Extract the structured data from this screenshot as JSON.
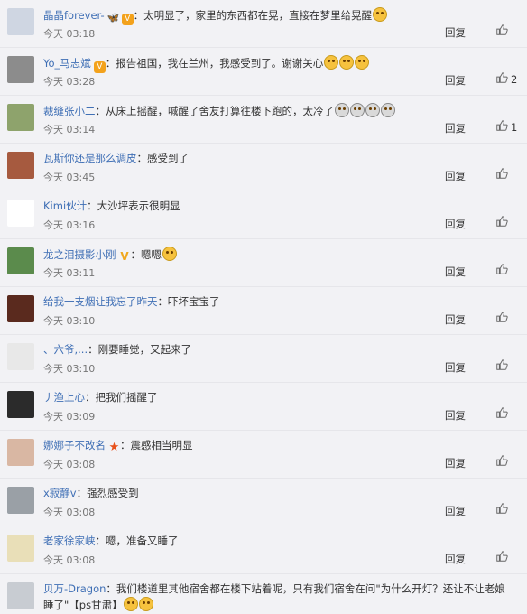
{
  "actions": {
    "reply_label": "回复",
    "like_icon": "thumbs-up-icon"
  },
  "comments": [
    {
      "user": "晶晶forever-",
      "text": "：太明显了，家里的东西都在晃，直接在梦里给晃醒",
      "time": "今天 03:18",
      "likes": "",
      "avatar_color": "#cfd6e2",
      "badges": [
        "butterfly",
        "vip"
      ],
      "emoji_count": 1
    },
    {
      "user": "Yo_马志斌",
      "text": "：报告祖国，我在兰州，我感受到了。谢谢关心",
      "time": "今天 03:28",
      "likes": "2",
      "avatar_color": "#8c8c8c",
      "badges": [
        "vip"
      ],
      "emoji_count": 3
    },
    {
      "user": "裁缝张小二",
      "text": "：从床上摇醒，喊醒了舍友打算往楼下跑的，太冷了",
      "time": "今天 03:14",
      "likes": "1",
      "avatar_color": "#8ea36c",
      "badges": [],
      "emoji_count": 4
    },
    {
      "user": "瓦斯你还是那么调皮",
      "text": "：感受到了",
      "time": "今天 03:45",
      "likes": "",
      "avatar_color": "#a65a3f",
      "badges": [],
      "emoji_count": 0
    },
    {
      "user": "Kimi伙计",
      "text": "：大沙坪表示很明显",
      "time": "今天 03:16",
      "likes": "",
      "avatar_color": "#ffffff",
      "badges": [],
      "emoji_count": 0
    },
    {
      "user": "龙之泪摄影小刚",
      "text": "：嗯嗯",
      "time": "今天 03:11",
      "likes": "",
      "avatar_color": "#5b8b4c",
      "badges": [
        "v"
      ],
      "emoji_count": 1
    },
    {
      "user": "给我一支烟让我忘了昨天",
      "text": "：吓坏宝宝了",
      "time": "今天 03:10",
      "likes": "",
      "avatar_color": "#5a2a1e",
      "badges": [],
      "emoji_count": 0
    },
    {
      "user": "、六爷,...",
      "text": "：刚要睡觉，又起来了",
      "time": "今天 03:10",
      "likes": "",
      "avatar_color": "#e8e8e8",
      "badges": [],
      "emoji_count": 0
    },
    {
      "user": "丿渔上心",
      "text": "：把我们摇醒了",
      "time": "今天 03:09",
      "likes": "",
      "avatar_color": "#2b2b2b",
      "badges": [],
      "emoji_count": 0
    },
    {
      "user": "娜娜子不改名",
      "text": "：震感相当明显",
      "time": "今天 03:08",
      "likes": "",
      "avatar_color": "#d9b7a3",
      "badges": [
        "star"
      ],
      "emoji_count": 0
    },
    {
      "user": "x寂静v",
      "text": "：强烈感受到",
      "time": "今天 03:08",
      "likes": "",
      "avatar_color": "#9aa0a6",
      "badges": [],
      "emoji_count": 0
    },
    {
      "user": "老家徐家峡",
      "text": "：嗯，准备又睡了",
      "time": "今天 03:08",
      "likes": "",
      "avatar_color": "#e9dfb8",
      "badges": [],
      "emoji_count": 0
    },
    {
      "user": "贝万-Dragon",
      "text": "：我们楼道里其他宿舍都在楼下站着呢，只有我们宿舍在问\"为什么开灯？还让不让老娘睡了\"【ps甘肃】",
      "time": "",
      "likes": "",
      "avatar_color": "#c8ccd2",
      "badges": [],
      "emoji_count": 2
    }
  ]
}
